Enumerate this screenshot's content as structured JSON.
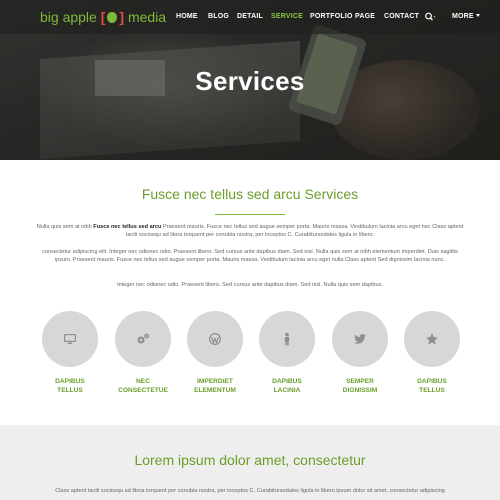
{
  "logo": {
    "text_left": "big apple",
    "bracket_open": "[",
    "bracket_close": "]",
    "text_right": "media"
  },
  "nav": {
    "items": [
      {
        "label": "HOME"
      },
      {
        "label": "BLOG"
      },
      {
        "label": "DETAIL"
      },
      {
        "label": "SERVICE",
        "active": true
      },
      {
        "label": "PORTFOLIO"
      },
      {
        "label": "PAGE"
      },
      {
        "label": "CONTACT"
      }
    ],
    "more_label": "MORE"
  },
  "hero": {
    "title": "Services"
  },
  "intro": {
    "title": "Fusce nec tellus sed arcu Services",
    "p1_before": "Nulla quis sem at nibh ",
    "p1_bold": "Fusce nec tellus sed arcu",
    "p1_after": " Praesent mauris. Fusce nec tellus sed augue semper porta. Mauris massa. Vestibulum lacinia arcu eget nec Class aptent taciti sociosqu ad litora torquent per conubia nostra, per inceptos C. Curabitursodales ligula in libero.",
    "p2": "consectetur adipiscing elit. Integer nec odionec odio. Praesent libero. Sed cursus ante dapibus diam. Sed nisl. Nulla quis sem at nibh elementum imperdiet. Duis sagittis ipsum. Praesent mauris. Fusce nec tellus sed augue semper porta. Mauris massa. Vestibulum lacinia arcu eget nulla.Class aptent Sed dignissim lacinia nunc.",
    "p3": "Integer nec odionec odio. Praesent libero. Sed cursus ante dapibus diam. Sed nisl. Nulla quis sem dapibus."
  },
  "services": [
    {
      "icon": "monitor-icon",
      "line1": "DAPIBUS",
      "line2": "TELLUS"
    },
    {
      "icon": "gears-icon",
      "line1": "NEC",
      "line2": "CONSECTETUE"
    },
    {
      "icon": "wordpress-icon",
      "line1": "IMPERDIET",
      "line2": "ELEMENTUM"
    },
    {
      "icon": "person-icon",
      "line1": "DAPIBUS",
      "line2": "LACINIA"
    },
    {
      "icon": "twitter-icon",
      "line1": "SEMPER",
      "line2": "DIGNISSIM"
    },
    {
      "icon": "star-icon",
      "line1": "DAPIBUS",
      "line2": "TELLUS"
    }
  ],
  "second": {
    "title": "Lorem ipsum dolor amet, consectetur",
    "text": "Class aptent taciti sociosqu ad litora torquent per conubia nostra, per inceptos C. Curabitursodales ligula in libero ipsum dolor sit amet, consectetur adipiscing"
  },
  "colors": {
    "accent": "#7fb93b",
    "bracket": "#e84c3d",
    "circle": "#d7d7d7",
    "band": "#eeeeee"
  }
}
